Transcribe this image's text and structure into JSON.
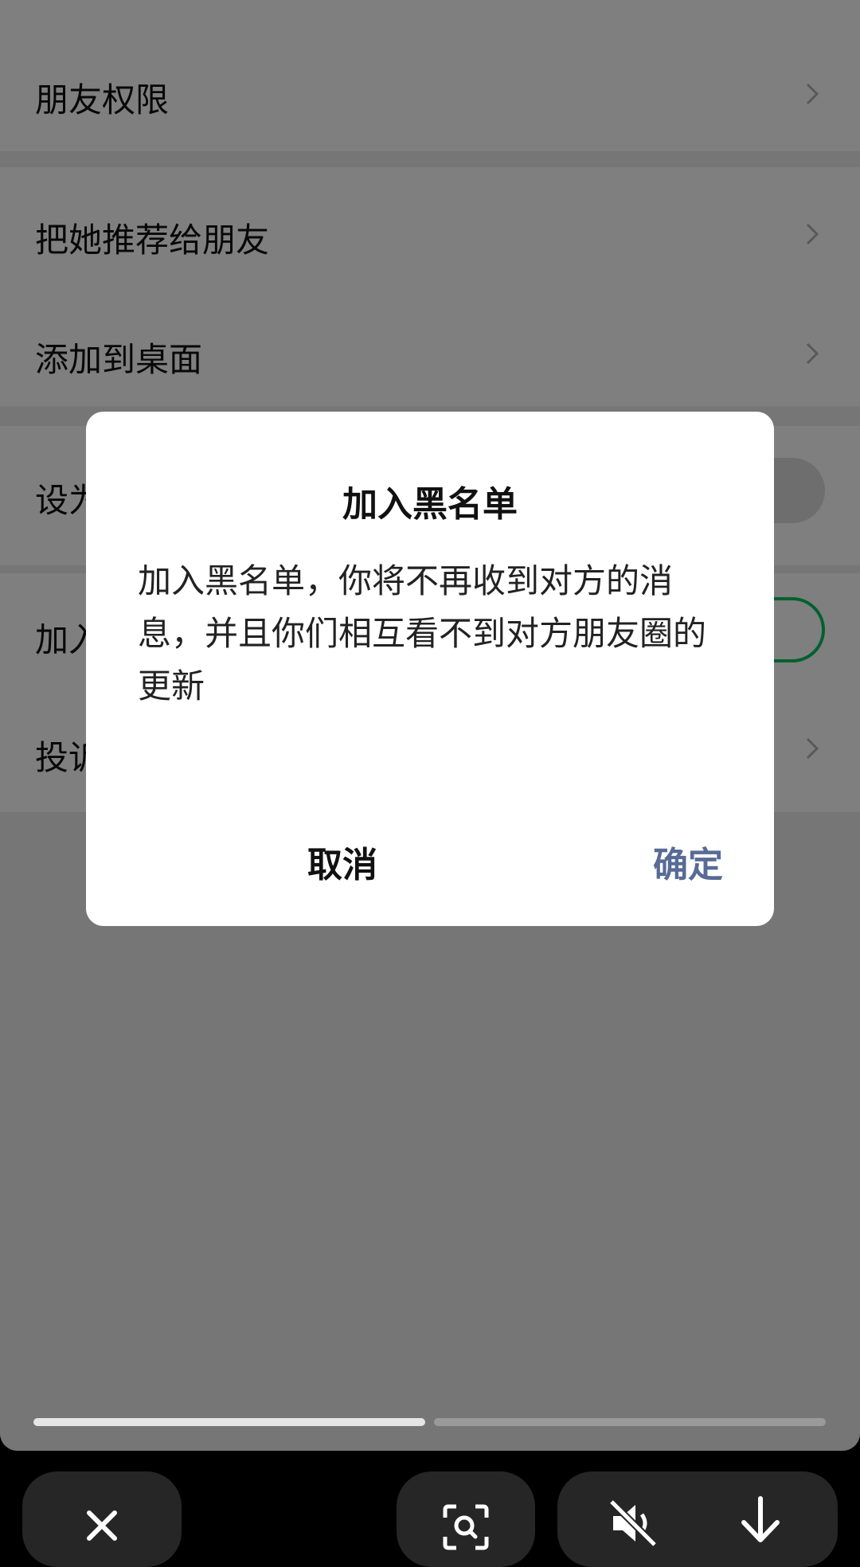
{
  "settings": {
    "friend_permissions": "朋友权限",
    "recommend_to_friend": "把她推荐给朋友",
    "add_to_desktop": "添加到桌面",
    "set_as_starred_prefix": "设为",
    "add_to_blacklist_prefix": "加入",
    "report_prefix": "投诉"
  },
  "dialog": {
    "title": "加入黑名单",
    "message": "加入黑名单，你将不再收到对方的消息，并且你们相互看不到对方朋友圈的更新",
    "cancel_label": "取消",
    "confirm_label": "确定"
  },
  "viewer": {
    "progress": 0.5
  },
  "icons": {
    "close": "close-icon",
    "scan": "scan-icon",
    "mute": "mute-icon",
    "download": "download-icon"
  },
  "colors": {
    "toggle_on": "#07c160",
    "confirm_text": "#576b95"
  }
}
